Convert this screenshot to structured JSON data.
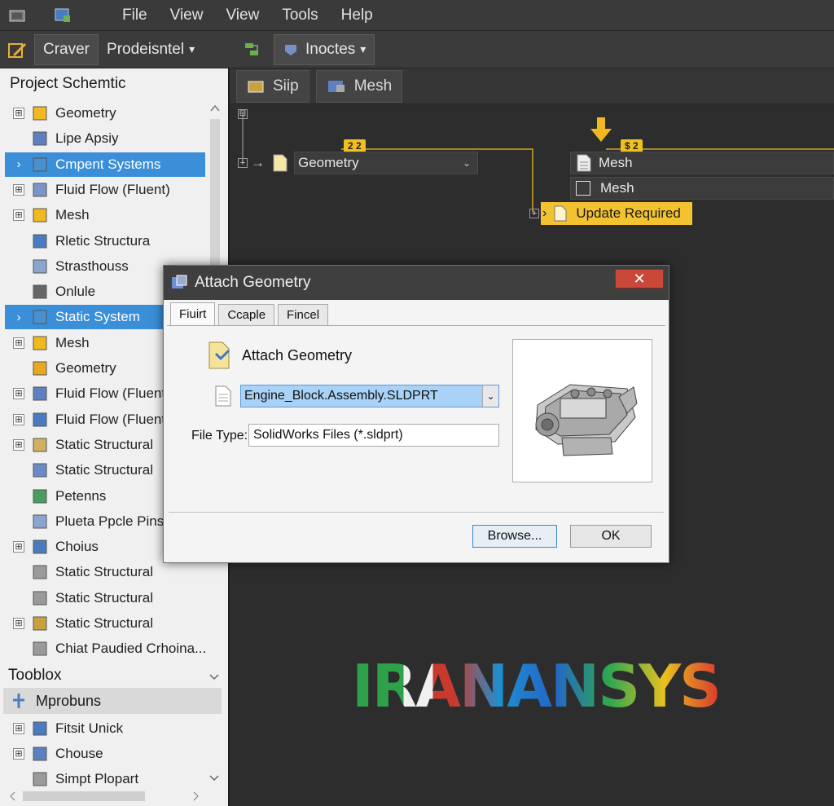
{
  "menubar": {
    "items": [
      "File",
      "View",
      "View",
      "Tools",
      "Help"
    ]
  },
  "left_toolbar": {
    "tab1": "Craver",
    "tab2": "Prodeisntel",
    "tab2_arrow": "▾"
  },
  "right_toolbar": {
    "tab": "Inoctes",
    "tab_arrow": "▾"
  },
  "right_tabs": [
    "Siip",
    "Mesh"
  ],
  "project_schematic": {
    "title": "Project Schemtic",
    "items": [
      {
        "label": "Geometry",
        "expander": "⊞",
        "selected": false
      },
      {
        "label": "Lipe Apsiy",
        "expander": "",
        "selected": false
      },
      {
        "label": "Cmpent Systems",
        "expander": "›",
        "selected": true
      },
      {
        "label": "Fluid Flow (Fluent)",
        "expander": "⊞",
        "selected": false
      },
      {
        "label": "Mesh",
        "expander": "⊞",
        "selected": false
      },
      {
        "label": "Rletic Structura",
        "expander": "",
        "selected": false
      },
      {
        "label": "Strasthouss",
        "expander": "",
        "selected": false
      },
      {
        "label": "Onlule",
        "expander": "",
        "selected": false
      },
      {
        "label": "Static System",
        "expander": "›",
        "selected": true
      },
      {
        "label": "Mesh",
        "expander": "⊞",
        "selected": false
      },
      {
        "label": "Geometry",
        "expander": "",
        "selected": false
      },
      {
        "label": "Fluid Flow (Fluent)",
        "expander": "⊞",
        "selected": false
      },
      {
        "label": "Fluid Flow (Fluent)",
        "expander": "⊞",
        "selected": false
      },
      {
        "label": "Static Structural",
        "expander": "⊞",
        "selected": false
      },
      {
        "label": "Static Structural",
        "expander": "",
        "selected": false
      },
      {
        "label": "Petenns",
        "expander": "",
        "selected": false
      },
      {
        "label": "Plueta Ppcle Pins",
        "expander": "",
        "selected": false
      },
      {
        "label": "Choius",
        "expander": "⊞",
        "selected": false
      },
      {
        "label": "Static Structural",
        "expander": "",
        "selected": false
      },
      {
        "label": "Static Structural",
        "expander": "",
        "selected": false
      },
      {
        "label": "Static Structural",
        "expander": "⊞",
        "selected": false
      },
      {
        "label": "Chiat Paudied Crhoina...",
        "expander": "",
        "selected": false
      }
    ]
  },
  "toolbox": {
    "title": "Tooblox",
    "group": "Mprobuns",
    "items": [
      {
        "label": "Fitsit Unick",
        "expander": "⊞"
      },
      {
        "label": "Chouse",
        "expander": "⊞"
      },
      {
        "label": "Simpt Plopart",
        "expander": ""
      }
    ]
  },
  "canvas": {
    "badge1": "2 2",
    "badge2": "$ 2",
    "geometry_label": "Geometry",
    "mesh_label_1": "Mesh",
    "mesh_label_2": "Mesh",
    "update_label": "Update Required",
    "plus": "+",
    "arrow": "→"
  },
  "dialog": {
    "title": "Attach Geometry",
    "close": "✕",
    "tabs": [
      "Fiuirt",
      "Ccaple",
      "Fincel"
    ],
    "heading": "Attach Geometry",
    "file_value": "Engine_Block.Assembly.SLDPRT",
    "file_type_label": "File Type:",
    "file_type_value": "SolidWorks Files (*.sldprt)",
    "browse_label": "Browse...",
    "ok_label": "OK"
  },
  "watermark": {
    "text": "IRANANSYS"
  },
  "colors": {
    "accent_blue": "#3a8fd8",
    "update_yellow": "#f2c230",
    "close_red": "#c9483a",
    "canvas_bg": "#2d2d2d"
  }
}
